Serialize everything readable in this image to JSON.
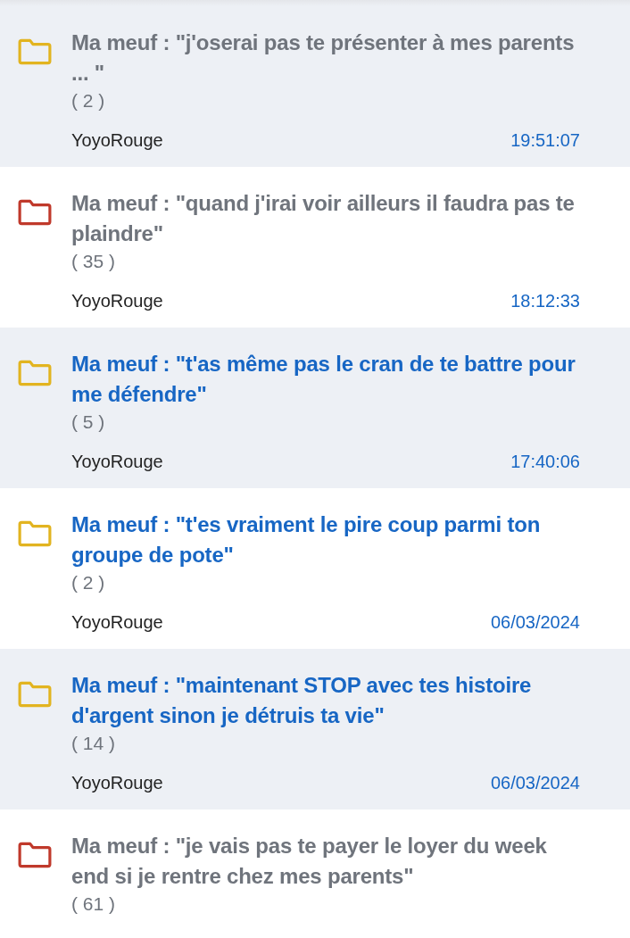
{
  "topics": [
    {
      "title": "Ma meuf : \"j'oserai pas te présenter à mes parents ... \"",
      "count": "( 2 )",
      "author": "YoyoRouge",
      "date": "19:51:07",
      "read": true,
      "color": "#e2b420"
    },
    {
      "title": "Ma meuf : \"quand j'irai voir ailleurs il faudra pas te plaindre\"",
      "count": "( 35 )",
      "author": "YoyoRouge",
      "date": "18:12:33",
      "read": true,
      "color": "#c0392b"
    },
    {
      "title": "Ma meuf : \"t'as même pas le cran de te battre pour me défendre\"",
      "count": "( 5 )",
      "author": "YoyoRouge",
      "date": "17:40:06",
      "read": false,
      "color": "#e2b420"
    },
    {
      "title": "Ma meuf : \"t'es vraiment le pire coup parmi ton groupe de pote\"",
      "count": "( 2 )",
      "author": "YoyoRouge",
      "date": "06/03/2024",
      "read": false,
      "color": "#e2b420"
    },
    {
      "title": "Ma meuf : \"maintenant STOP avec tes histoire d'argent sinon je détruis ta vie\"",
      "count": "( 14 )",
      "author": "YoyoRouge",
      "date": "06/03/2024",
      "read": false,
      "color": "#e2b420"
    },
    {
      "title": "Ma meuf : \"je vais pas te payer le loyer du week end si je rentre chez mes parents\"",
      "count": "( 61 )",
      "read": true,
      "color": "#c0392b"
    }
  ]
}
